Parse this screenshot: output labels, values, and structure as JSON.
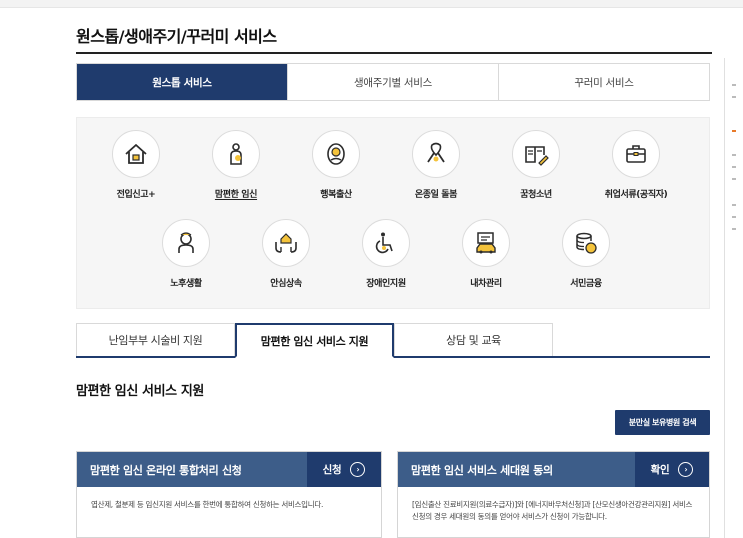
{
  "page_title": "원스톱/생애주기/꾸러미 서비스",
  "main_tabs": [
    {
      "label": "원스톱 서비스",
      "active": true
    },
    {
      "label": "생애주기별 서비스",
      "active": false
    },
    {
      "label": "꾸러미 서비스",
      "active": false
    }
  ],
  "services": [
    {
      "label": "전입신고+",
      "icon": "house-icon"
    },
    {
      "label": "맘편한 임신",
      "icon": "pregnant-woman-icon",
      "selected": true
    },
    {
      "label": "행복출산",
      "icon": "baby-icon"
    },
    {
      "label": "온종일 돌봄",
      "icon": "ribbon-icon"
    },
    {
      "label": "꿈청소년",
      "icon": "book-pencil-icon"
    },
    {
      "label": "취업서류(공직자)",
      "icon": "briefcase-icon"
    },
    {
      "label": "노후생활",
      "icon": "elderly-icon"
    },
    {
      "label": "안심상속",
      "icon": "hands-house-icon"
    },
    {
      "label": "장애인지원",
      "icon": "wheelchair-icon"
    },
    {
      "label": "내차관리",
      "icon": "car-document-icon"
    },
    {
      "label": "서민금융",
      "icon": "coins-icon"
    }
  ],
  "sub_tabs": [
    {
      "label": "난임부부 시술비 지원",
      "active": false
    },
    {
      "label": "맘편한 임신 서비스 지원",
      "active": true
    },
    {
      "label": "상담 및 교육",
      "active": false
    }
  ],
  "section_title": "맘편한 임신 서비스 지원",
  "search_button_label": "분만실 보유병원 검색",
  "cards": [
    {
      "title": "맘편한 임신 온라인 통합처리 신청",
      "action": "신청",
      "description": "엽산제, 철분제 등 임신지원 서비스를 한번에 통합하여 신청하는 서비스입니다."
    },
    {
      "title": "맘편한 임신 서비스 세대원 동의",
      "action": "확인",
      "description": "[임신출산 진료비지원(의료수급자)]와 [에너지바우처신청]과 [산모신생아건강관리지원] 서비스 신청의 경우 세대원의 동의를 얻어야 서비스가 신청이 가능합니다."
    }
  ],
  "colors": {
    "navy": "#1f3b6d",
    "card_header": "#3d5d89",
    "icon_yellow": "#f4c33b",
    "icon_line": "#2c2c2c"
  }
}
